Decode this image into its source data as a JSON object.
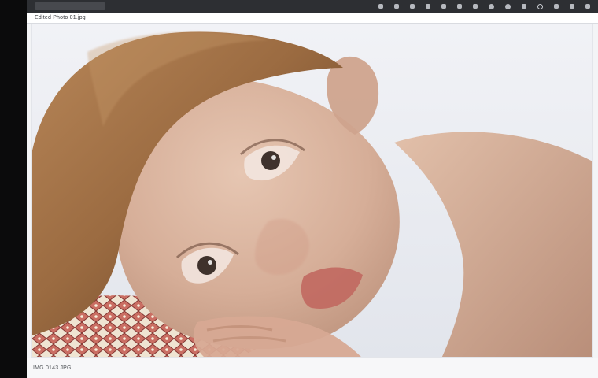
{
  "window": {
    "file_label": "Edited Photo 01.jpg",
    "status_text": "IMG 0143.JPG"
  },
  "toolbar": {
    "icons": [
      "crop-icon",
      "adjust-icon",
      "brush-icon",
      "text-icon",
      "shape-icon",
      "filter-icon",
      "layers-icon",
      "undo-icon",
      "redo-icon",
      "zoom-icon",
      "settings-icon",
      "info-icon",
      "share-icon",
      "export-icon"
    ]
  },
  "colors": {
    "toolbar_bg": "#2d2f33",
    "canvas_bg": "#eceef3",
    "skin_base": "#d7b19b",
    "hair_base": "#9a6c42",
    "fabric_red": "#c55b50",
    "fabric_cream": "#f0e4d1"
  }
}
